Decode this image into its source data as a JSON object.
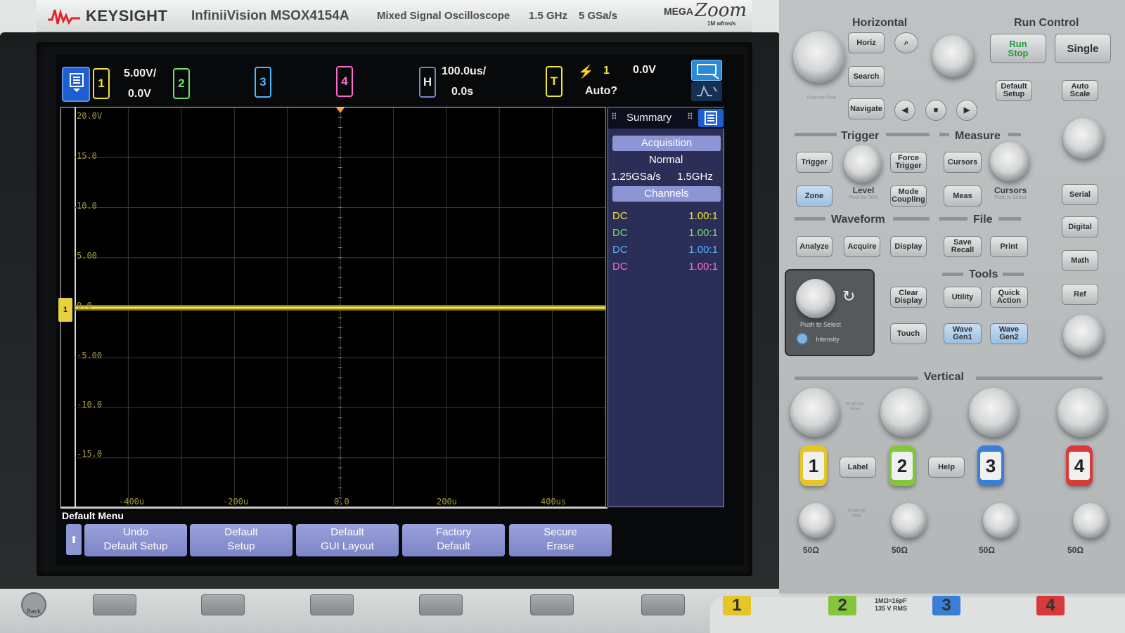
{
  "instrument": {
    "brand": "KEYSIGHT",
    "model": "InfiniiVision MSOX4154A",
    "type": "Mixed Signal Oscilloscope",
    "bandwidth": "1.5 GHz",
    "sample_rate": "5 GSa/s",
    "megazoom": {
      "prefix": "MEGA",
      "word": "Zoom",
      "sub": "1M wfms/s"
    }
  },
  "status_bar": {
    "ch1": {
      "label": "1",
      "scale": "5.00V/",
      "offset": "0.0V"
    },
    "ch2": {
      "label": "2"
    },
    "ch3": {
      "label": "3"
    },
    "ch4": {
      "label": "4"
    },
    "horizontal": {
      "label": "H",
      "scale": "100.0us/",
      "delay": "0.0s"
    },
    "trigger": {
      "label": "T",
      "source": "1",
      "level": "0.0V",
      "mode": "Auto?"
    }
  },
  "plot": {
    "y_labels": [
      "20.0V",
      "15.0",
      "10.0",
      "5.00",
      "0.0",
      "-5.00",
      "-10.0",
      "-15.0"
    ],
    "x_labels": [
      "-400u",
      "-200u",
      "0.0",
      "200u",
      "400us"
    ],
    "ground_marker": "1"
  },
  "summary": {
    "title": "Summary",
    "acquisition_header": "Acquisition",
    "acq_mode": "Normal",
    "acq_rate": "1.25GSa/s",
    "acq_bw": "1.5GHz",
    "channels_header": "Channels",
    "channels": [
      {
        "coupling": "DC",
        "probe": "1.00:1",
        "color": "#f2e43c"
      },
      {
        "coupling": "DC",
        "probe": "1.00:1",
        "color": "#6fe26a"
      },
      {
        "coupling": "DC",
        "probe": "1.00:1",
        "color": "#52b6ff"
      },
      {
        "coupling": "DC",
        "probe": "1.00:1",
        "color": "#ff6ad0"
      }
    ]
  },
  "softkeys": {
    "menu_title": "Default Menu",
    "back": "⬆",
    "keys": [
      {
        "line1": "Undo",
        "line2": "Default Setup"
      },
      {
        "line1": "Default",
        "line2": "Setup"
      },
      {
        "line1": "Default",
        "line2": "GUI Layout"
      },
      {
        "line1": "Factory",
        "line2": "Default"
      },
      {
        "line1": "Secure",
        "line2": "Erase"
      }
    ]
  },
  "front_panel": {
    "horizontal": {
      "title": "Horizontal",
      "horiz": "Horiz",
      "search": "Search",
      "navigate": "Navigate",
      "push_fine": "Push for Fine"
    },
    "run_control": {
      "title": "Run Control",
      "run": "Run",
      "stop": "Stop",
      "single": "Single",
      "default_setup": "Default Setup",
      "auto_scale": "Auto Scale"
    },
    "trigger": {
      "title": "Trigger",
      "trigger": "Trigger",
      "force_trigger": "Force Trigger",
      "zone": "Zone",
      "level": "Level",
      "level_sub": "Push for 50%",
      "mode_coupling": "Mode Coupling"
    },
    "measure": {
      "title": "Measure",
      "cursors": "Cursors",
      "meas": "Meas",
      "cursors_knob": "Cursors",
      "cursors_sub": "Push to Select"
    },
    "waveform": {
      "title": "Waveform",
      "analyze": "Analyze",
      "acquire": "Acquire",
      "display": "Display"
    },
    "file": {
      "title": "File",
      "save_recall": "Save Recall",
      "print": "Print"
    },
    "tools": {
      "title": "Tools",
      "clear_display": "Clear Display",
      "utility": "Utility",
      "quick_action": "Quick Action",
      "touch": "Touch",
      "wavegen1": "Wave Gen1",
      "wavegen2": "Wave Gen2"
    },
    "entry": {
      "push_to_select": "Push to Select",
      "intensity": "Intensity"
    },
    "side_keys": {
      "serial": "Serial",
      "digital": "Digital",
      "math": "Math",
      "ref": "Ref"
    },
    "vertical": {
      "title": "Vertical",
      "label": "Label",
      "help": "Help",
      "ohm": "50Ω",
      "push_fine": "Push for Fine",
      "push_zero": "Push to Zero"
    },
    "inputs": {
      "ch1": "1",
      "ch2": "2",
      "ch3": "3",
      "ch4": "4",
      "rating1": "1MΩ≈16pF",
      "rating2": "135 V RMS",
      "back": "Back"
    }
  }
}
